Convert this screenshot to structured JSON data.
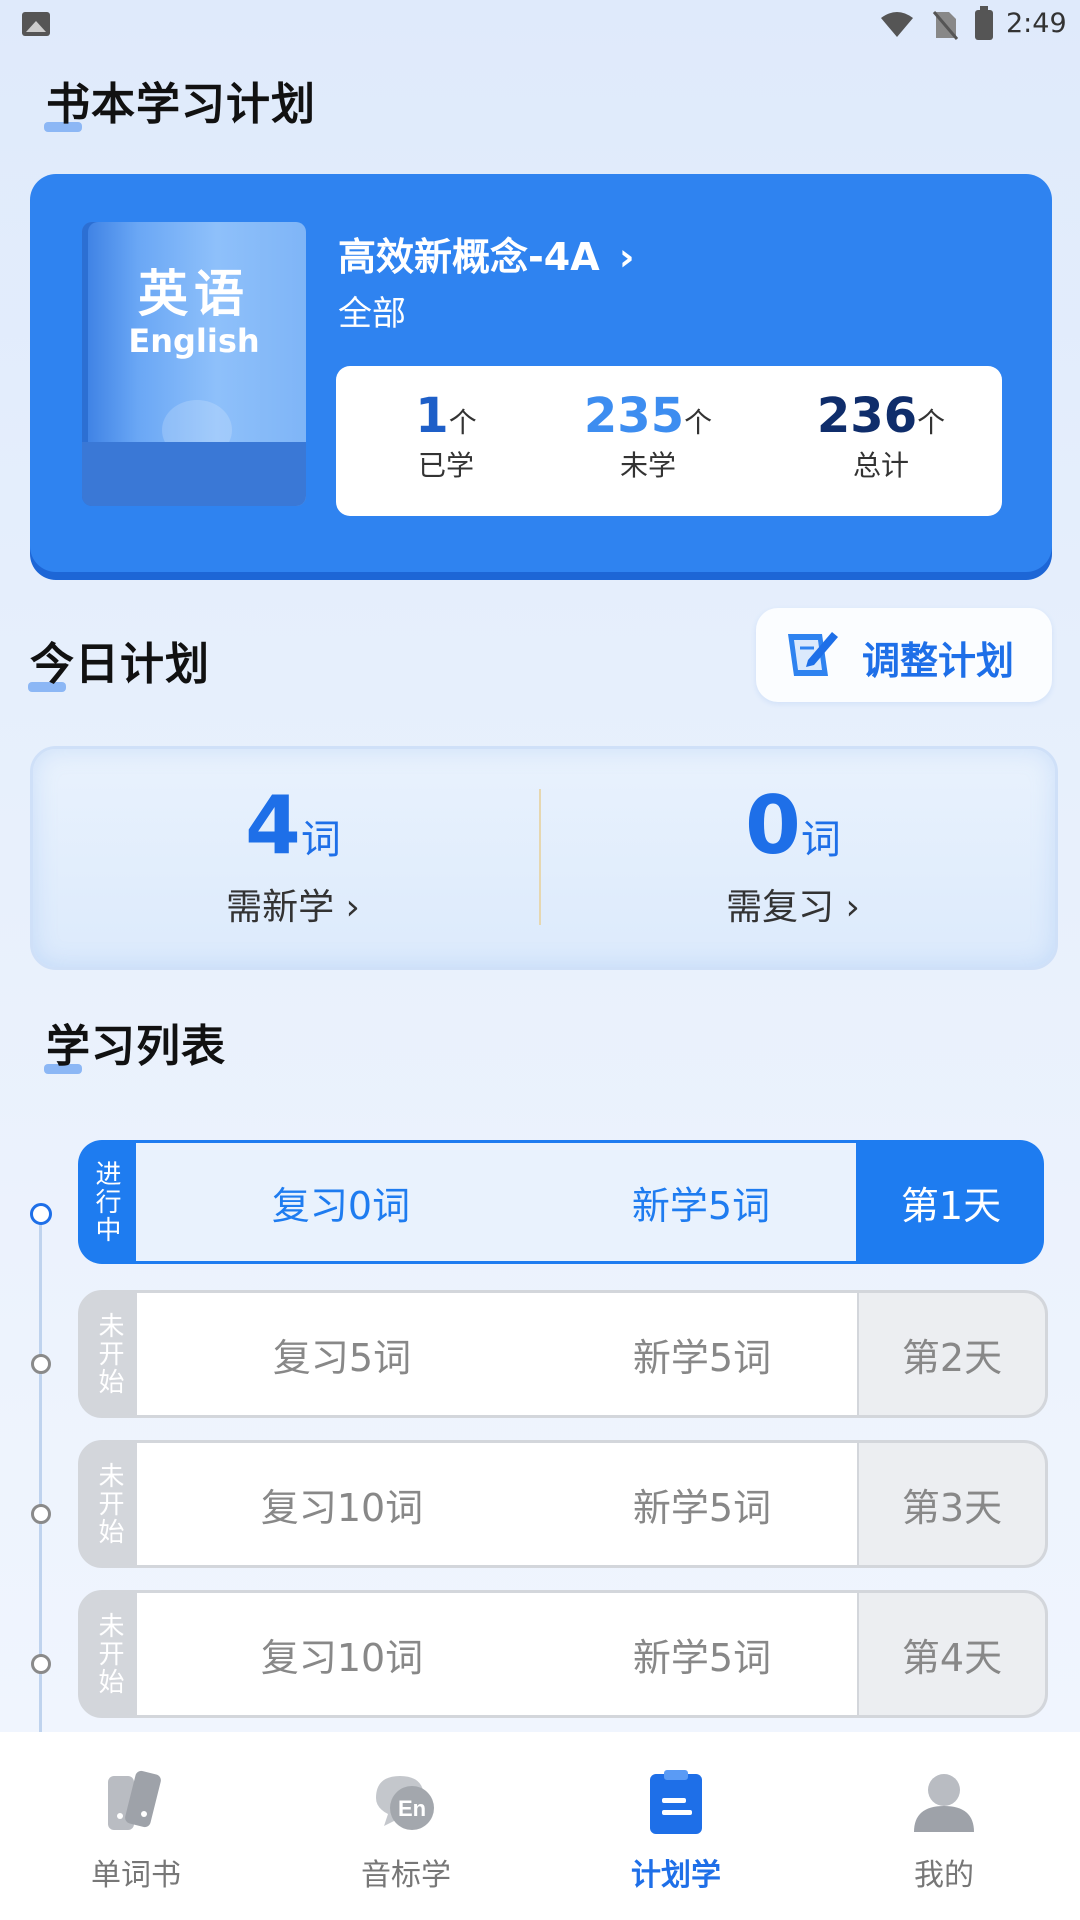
{
  "status_bar": {
    "time": "2:49"
  },
  "book_section": {
    "title": "书本学习计划",
    "book": {
      "cover_cn": "英语",
      "cover_en": "English",
      "name": "高效新概念-4A",
      "arrow": "›",
      "scope": "全部"
    },
    "stats": [
      {
        "value": "1",
        "unit": "个",
        "label": "已学",
        "color": "#1e5fc8"
      },
      {
        "value": "235",
        "unit": "个",
        "label": "未学",
        "color": "#3d8df0"
      },
      {
        "value": "236",
        "unit": "个",
        "label": "总计",
        "color": "#0f2d6b"
      }
    ]
  },
  "today": {
    "title": "今日计划",
    "adjust_label": "调整计划",
    "new": {
      "value": "4",
      "unit": "词",
      "label": "需新学 ›"
    },
    "review": {
      "value": "0",
      "unit": "词",
      "label": "需复习 ›"
    }
  },
  "list": {
    "title": "学习列表",
    "rows": [
      {
        "status": "进行中",
        "review": "复习0词",
        "new": "新学5词",
        "day": "第1天",
        "active": true
      },
      {
        "status": "未开始",
        "review": "复习5词",
        "new": "新学5词",
        "day": "第2天",
        "active": false
      },
      {
        "status": "未开始",
        "review": "复习10词",
        "new": "新学5词",
        "day": "第3天",
        "active": false
      },
      {
        "status": "未开始",
        "review": "复习10词",
        "new": "新学5词",
        "day": "第4天",
        "active": false
      }
    ]
  },
  "nav": {
    "items": [
      {
        "label": "单词书",
        "icon": "word-book-icon",
        "active": false
      },
      {
        "label": "音标学",
        "icon": "phonetic-icon",
        "active": false
      },
      {
        "label": "计划学",
        "icon": "plan-icon",
        "active": true
      },
      {
        "label": "我的",
        "icon": "profile-icon",
        "active": false
      }
    ]
  },
  "colors": {
    "primary": "#1e6fe8",
    "card_blue": "#2f83f0",
    "inactive_gray": "#d3d6db"
  }
}
